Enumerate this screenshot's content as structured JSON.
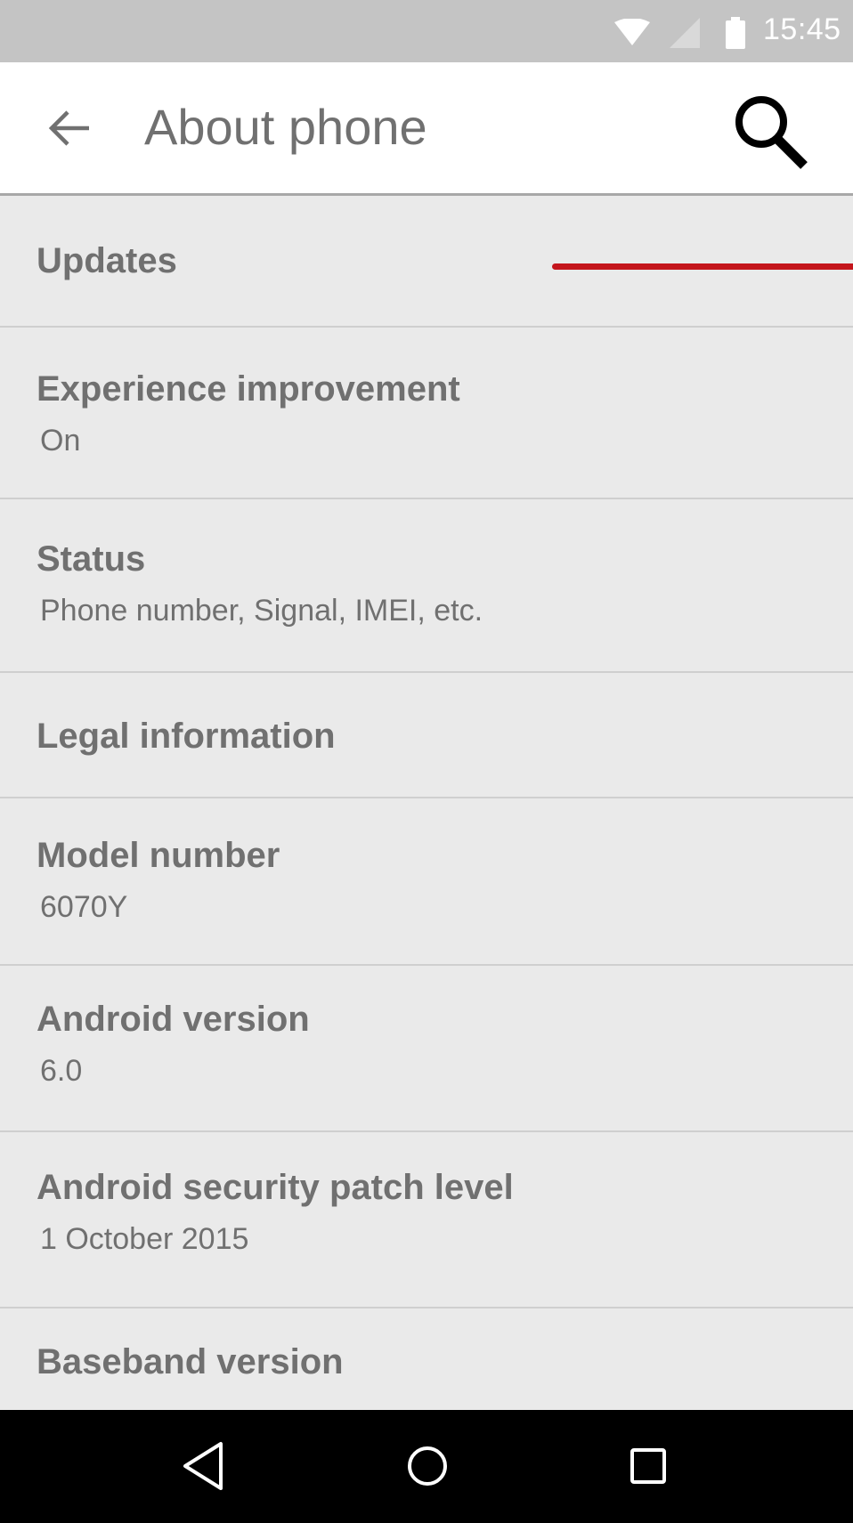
{
  "status_bar": {
    "time": "15:45",
    "icons": [
      "wifi-icon",
      "cell-signal-icon",
      "battery-icon"
    ]
  },
  "app_bar": {
    "title": "About phone",
    "back_icon": "arrow-back-icon",
    "search_icon": "search-icon"
  },
  "list": {
    "items": [
      {
        "title": "Updates",
        "summary": ""
      },
      {
        "title": "Experience improvement",
        "summary": "On"
      },
      {
        "title": "Status",
        "summary": "Phone number, Signal, IMEI, etc."
      },
      {
        "title": "Legal information",
        "summary": ""
      },
      {
        "title": "Model number",
        "summary": "6070Y"
      },
      {
        "title": "Android version",
        "summary": "6.0"
      },
      {
        "title": "Android security patch level",
        "summary": "1 October 2015"
      },
      {
        "title": "Baseband version",
        "summary": ""
      }
    ]
  },
  "nav_bar": {
    "icons": [
      "nav-back-icon",
      "nav-home-icon",
      "nav-recents-icon"
    ]
  },
  "colors": {
    "status_bar": "#c4c4c4",
    "app_bar": "#ffffff",
    "list_background": "#eaeaea",
    "text": "#707070",
    "accent": "#c4151c",
    "nav_bar": "#000000"
  }
}
